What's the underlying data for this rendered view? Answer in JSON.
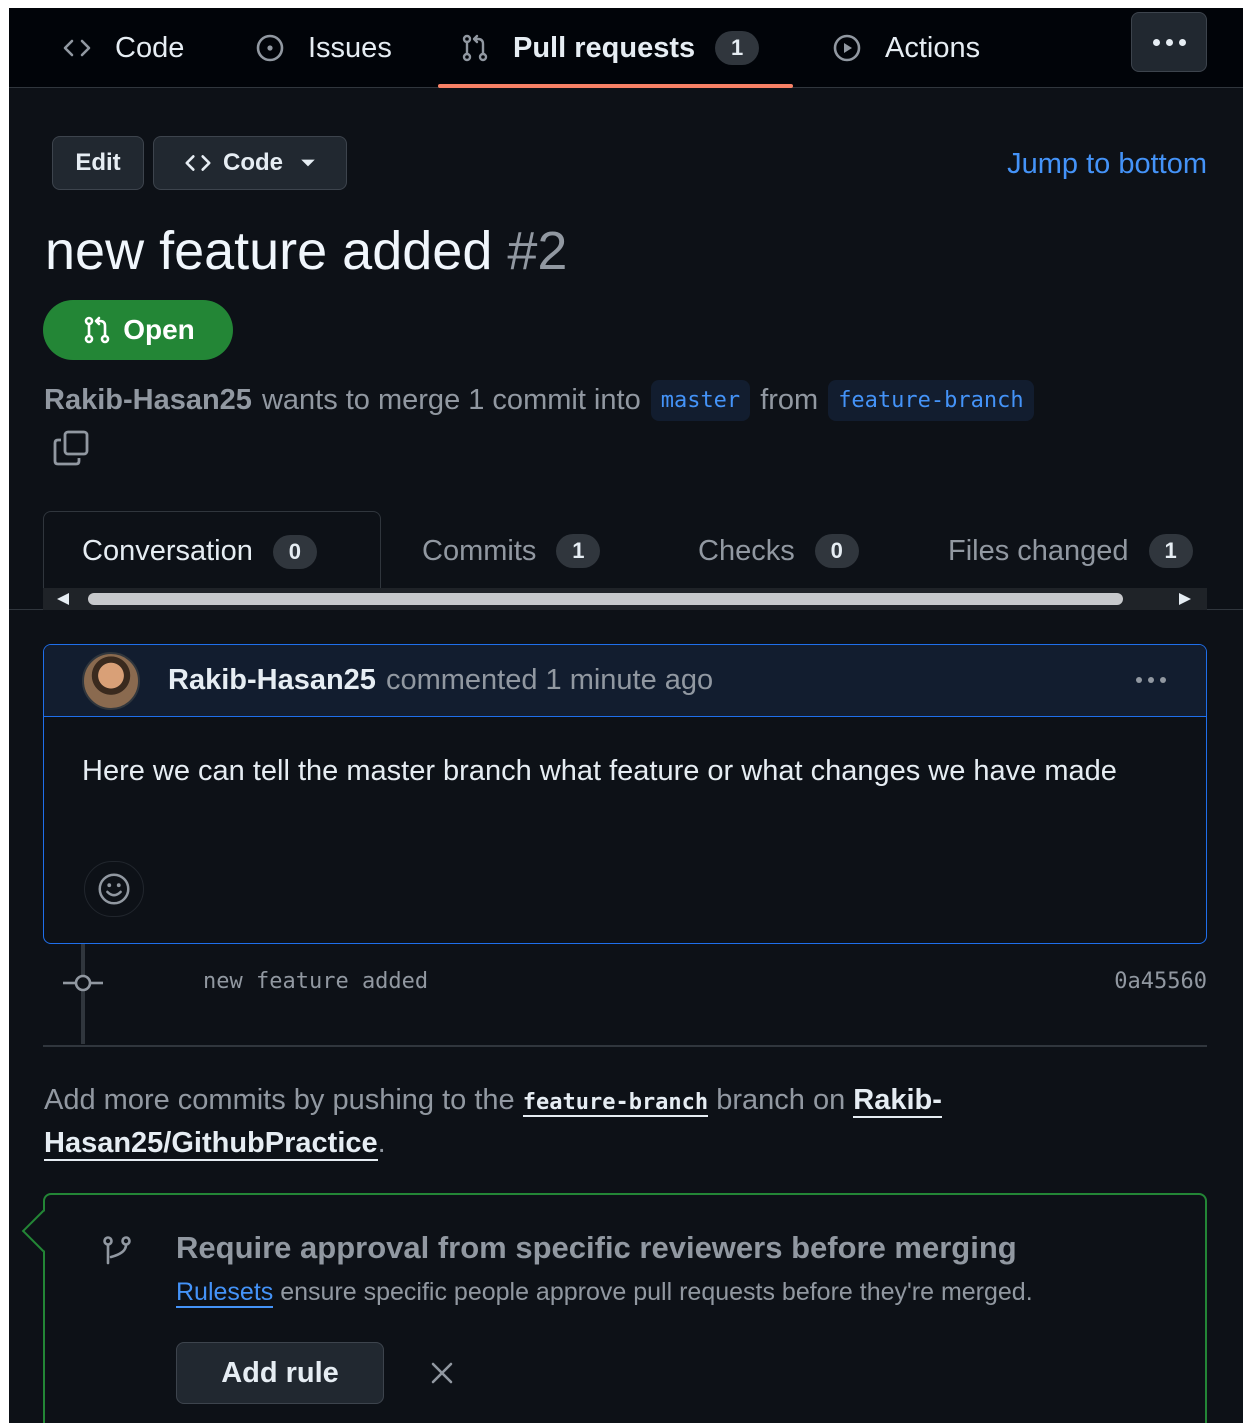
{
  "nav": {
    "items": [
      {
        "label": "Code",
        "icon": "code-icon"
      },
      {
        "label": "Issues",
        "icon": "issue-icon"
      },
      {
        "label": "Pull requests",
        "icon": "pull-request-icon",
        "count": "1",
        "active": true
      },
      {
        "label": "Actions",
        "icon": "play-icon"
      }
    ]
  },
  "toolbar": {
    "edit_label": "Edit",
    "code_label": "Code",
    "jump_label": "Jump to bottom"
  },
  "pr": {
    "title": "new feature added",
    "number": "#2",
    "state": "Open",
    "author": "Rakib-Hasan25",
    "merge_text_1": "wants to merge 1 commit into",
    "base_branch": "master",
    "merge_text_2": "from",
    "head_branch": "feature-branch"
  },
  "tabs": [
    {
      "label": "Conversation",
      "count": "0",
      "active": true
    },
    {
      "label": "Commits",
      "count": "1"
    },
    {
      "label": "Checks",
      "count": "0"
    },
    {
      "label": "Files changed",
      "count": "1"
    }
  ],
  "comment": {
    "author": "Rakib-Hasan25",
    "meta": "commented 1 minute ago",
    "body": "Here we can tell the master branch what feature or what changes we have made"
  },
  "commit": {
    "message": "new feature added",
    "sha": "0a45560"
  },
  "hint": {
    "prefix": "Add more commits by pushing to the",
    "branch": "feature-branch",
    "middle": "branch on",
    "repo": "Rakib-Hasan25/GithubPractice",
    "suffix": "."
  },
  "rule": {
    "title": "Require approval from specific reviewers before merging",
    "link": "Rulesets",
    "desc": "ensure specific people approve pull requests before they're merged.",
    "button": "Add rule"
  },
  "colors": {
    "accent_link": "#4493f8",
    "open_green": "#238636",
    "underline": "#f78166",
    "background": "#0d1117"
  }
}
